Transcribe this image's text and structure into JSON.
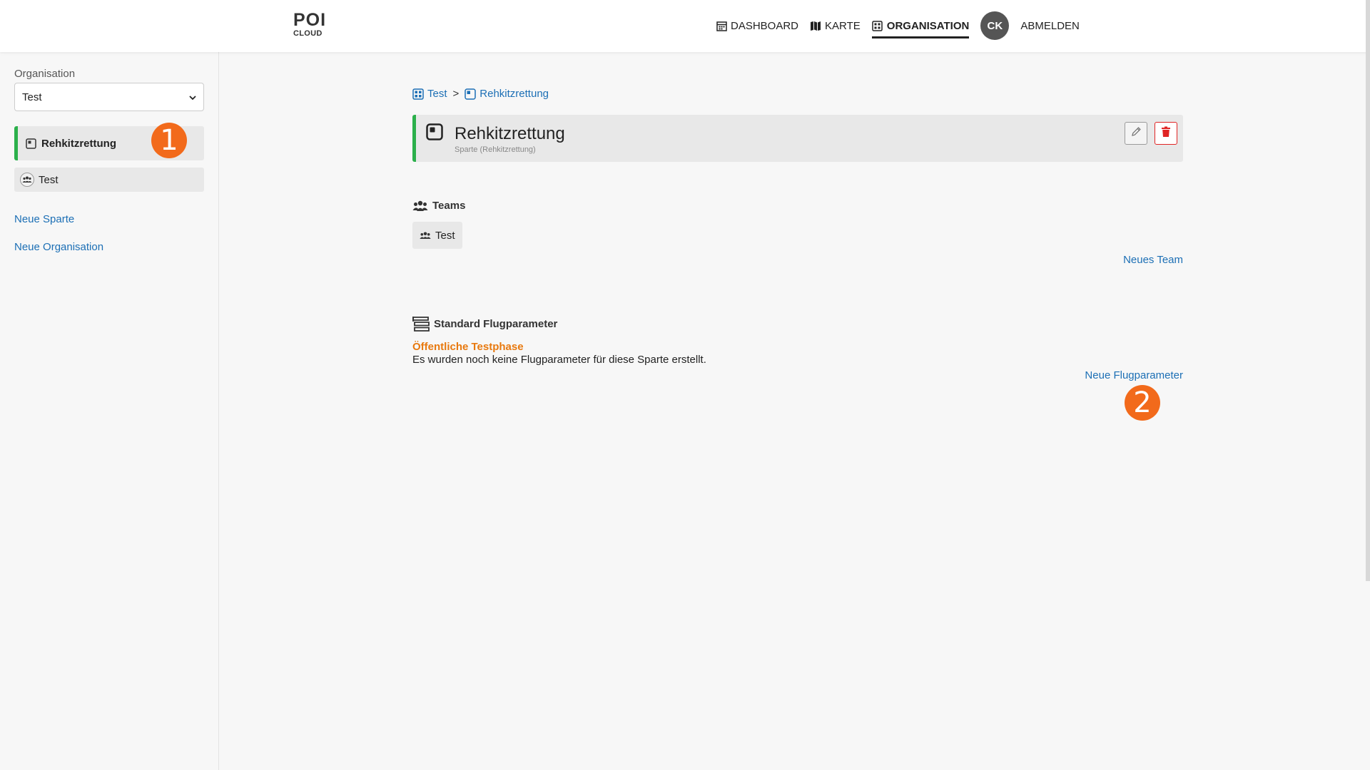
{
  "header": {
    "logo_top": "POI",
    "logo_bottom": "CLOUD",
    "nav": [
      {
        "label": "DASHBOARD",
        "icon": "calendar-icon"
      },
      {
        "label": "KARTE",
        "icon": "map-icon"
      },
      {
        "label": "ORGANISATION",
        "icon": "grid-icon",
        "active": true
      }
    ],
    "avatar_initials": "CK",
    "logout_label": "ABMELDEN"
  },
  "sidebar": {
    "org_label": "Organisation",
    "org_selected": "Test",
    "items": [
      {
        "label": "Rehkitzrettung",
        "icon": "division-icon",
        "active": true
      },
      {
        "label": "Test",
        "icon": "team-icon",
        "active": false
      }
    ],
    "links": {
      "new_division": "Neue Sparte",
      "new_organisation": "Neue Organisation"
    }
  },
  "breadcrumb": {
    "org": "Test",
    "separator": ">",
    "division": "Rehkitzrettung"
  },
  "title_card": {
    "title": "Rehkitzrettung",
    "subtitle": "Sparte (Rehkitzrettung)"
  },
  "teams": {
    "heading": "Teams",
    "items": [
      "Test"
    ],
    "new_team_label": "Neues Team"
  },
  "flight_params": {
    "heading": "Standard Flugparameter",
    "testphase": "Öffentliche Testphase",
    "empty_text": "Es wurden noch keine Flugparameter für diese Sparte erstellt.",
    "new_label": "Neue Flugparameter"
  },
  "annotations": {
    "badge_1": "1",
    "badge_2": "2"
  },
  "colors": {
    "accent_green": "#2bb04b",
    "link_blue": "#1c6fb5",
    "badge_orange": "#f26a1b",
    "testphase_orange": "#e8790f",
    "delete_red": "#e02424"
  }
}
